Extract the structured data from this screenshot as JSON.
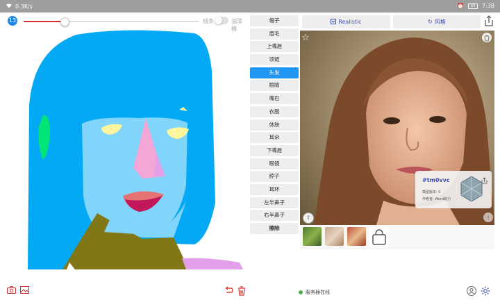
{
  "status_bar": {
    "carrier": "0.3K/s",
    "time": "7:38",
    "battery": "69"
  },
  "toolbar": {
    "brush_size": "13",
    "slider_value": 0.23,
    "mode_lines": "线条",
    "mode_fill": "油漆桶"
  },
  "labels": [
    {
      "text": "帽子",
      "active": false
    },
    {
      "text": "眉毛",
      "active": false
    },
    {
      "text": "上嘴唇",
      "active": false
    },
    {
      "text": "项链",
      "active": false
    },
    {
      "text": "头发",
      "active": true
    },
    {
      "text": "眼睛",
      "active": false
    },
    {
      "text": "嘴巴",
      "active": false
    },
    {
      "text": "衣服",
      "active": false
    },
    {
      "text": "体肤",
      "active": false
    },
    {
      "text": "耳朵",
      "active": false
    },
    {
      "text": "下嘴唇",
      "active": false
    },
    {
      "text": "眼镜",
      "active": false
    },
    {
      "text": "脖子",
      "active": false
    },
    {
      "text": "耳环",
      "active": false
    },
    {
      "text": "左半鼻子",
      "active": false
    },
    {
      "text": "右半鼻子",
      "active": false
    },
    {
      "text": "擦除",
      "active": false
    }
  ],
  "top_buttons": {
    "realistic_label": "Realistic",
    "style_label": "风格"
  },
  "result_card": {
    "id": "#tm0vvc",
    "line1": "模型版本: 0",
    "line2": "作者者: Word助力"
  },
  "server_status": "服务器在线",
  "colors": {
    "hair": "#03a9f4",
    "skin": "#81d4fa",
    "nose": "#f4a6d7",
    "lips": "#e57373",
    "clothes": "#827717",
    "eyes": "#fff59d",
    "accent_red": "#d32f2f",
    "accent_blue": "#2196f3"
  },
  "icons": {
    "camera": "camera-icon",
    "image": "image-icon",
    "undo": "undo-icon",
    "trash": "trash-icon",
    "share": "share-icon",
    "user": "user-icon",
    "settings": "gear-icon",
    "star": "star-icon",
    "bag": "bag-icon",
    "upload": "cloud-upload-icon",
    "info": "info-icon"
  }
}
